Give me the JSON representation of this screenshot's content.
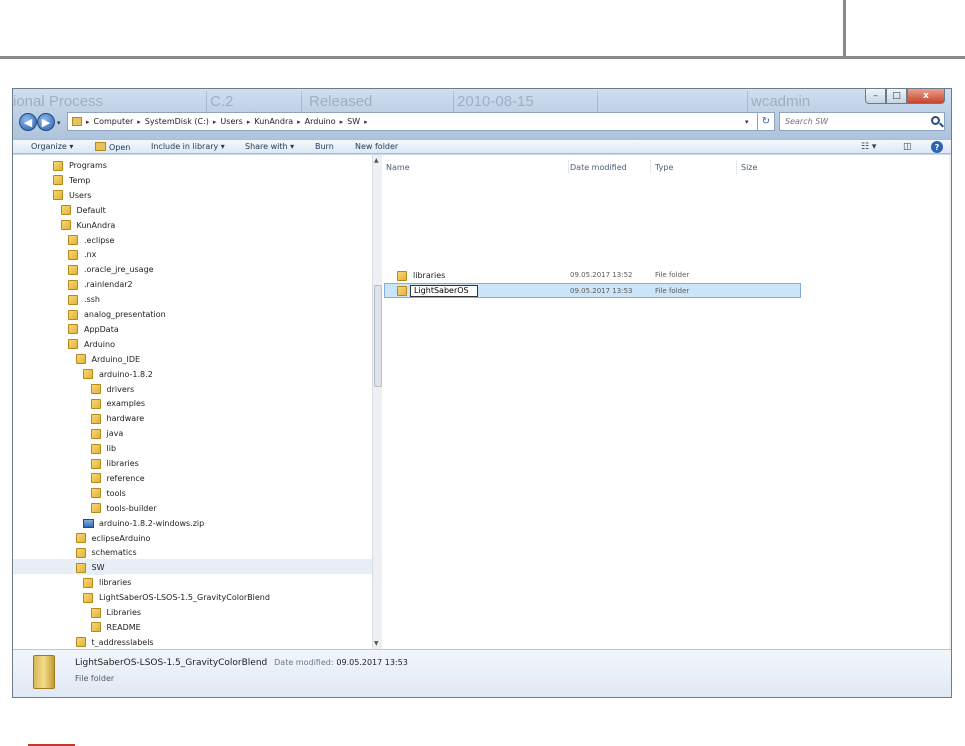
{
  "ghost_text": [
    "ional Process",
    "C.2",
    "Released",
    "2010-08-15",
    "wcadmin"
  ],
  "window_buttons": {
    "minimize": "–",
    "maximize": "□",
    "close": "x"
  },
  "nav": {
    "back_glyph": "◀",
    "forward_glyph": "▶",
    "breadcrumb": [
      "Computer",
      "SystemDisk (C:)",
      "Users",
      "KunAndra",
      "Arduino",
      "SW"
    ],
    "search_placeholder": "Search SW"
  },
  "toolbar": {
    "organize": "Organize ▾",
    "open": "Open",
    "include": "Include in library ▾",
    "share": "Share with ▾",
    "burn": "Burn",
    "new_folder": "New folder"
  },
  "tree": [
    {
      "label": "Programs",
      "indent": 0,
      "icon": "folder"
    },
    {
      "label": "Temp",
      "indent": 0,
      "icon": "folder"
    },
    {
      "label": "Users",
      "indent": 0,
      "icon": "folder"
    },
    {
      "label": "Default",
      "indent": 1,
      "icon": "folder"
    },
    {
      "label": "KunAndra",
      "indent": 1,
      "icon": "folder"
    },
    {
      "label": ".eclipse",
      "indent": 2,
      "icon": "folder"
    },
    {
      "label": ".nx",
      "indent": 2,
      "icon": "folder"
    },
    {
      "label": ".oracle_jre_usage",
      "indent": 2,
      "icon": "folder"
    },
    {
      "label": ".rainlendar2",
      "indent": 2,
      "icon": "folder"
    },
    {
      "label": ".ssh",
      "indent": 2,
      "icon": "folder"
    },
    {
      "label": "analog_presentation",
      "indent": 2,
      "icon": "folder"
    },
    {
      "label": "AppData",
      "indent": 2,
      "icon": "folder"
    },
    {
      "label": "Arduino",
      "indent": 2,
      "icon": "folder"
    },
    {
      "label": "Arduino_IDE",
      "indent": 3,
      "icon": "folder"
    },
    {
      "label": "arduino-1.8.2",
      "indent": 4,
      "icon": "folder"
    },
    {
      "label": "drivers",
      "indent": 5,
      "icon": "folder"
    },
    {
      "label": "examples",
      "indent": 5,
      "icon": "folder"
    },
    {
      "label": "hardware",
      "indent": 5,
      "icon": "folder"
    },
    {
      "label": "java",
      "indent": 5,
      "icon": "folder"
    },
    {
      "label": "lib",
      "indent": 5,
      "icon": "folder"
    },
    {
      "label": "libraries",
      "indent": 5,
      "icon": "folder"
    },
    {
      "label": "reference",
      "indent": 5,
      "icon": "folder"
    },
    {
      "label": "tools",
      "indent": 5,
      "icon": "folder"
    },
    {
      "label": "tools-builder",
      "indent": 5,
      "icon": "folder"
    },
    {
      "label": "arduino-1.8.2-windows.zip",
      "indent": 4,
      "icon": "zip"
    },
    {
      "label": "eclipseArduino",
      "indent": 3,
      "icon": "folder"
    },
    {
      "label": "schematics",
      "indent": 3,
      "icon": "folder"
    },
    {
      "label": "SW",
      "indent": 3,
      "icon": "folder",
      "selected": true
    },
    {
      "label": "libraries",
      "indent": 4,
      "icon": "folder"
    },
    {
      "label": "LightSaberOS-LSOS-1.5_GravityColorBlend",
      "indent": 4,
      "icon": "folder"
    },
    {
      "label": "Libraries",
      "indent": 5,
      "icon": "folder"
    },
    {
      "label": "README",
      "indent": 5,
      "icon": "folder"
    },
    {
      "label": "t_addresslabels",
      "indent": 3,
      "icon": "folder"
    }
  ],
  "columns": {
    "name": "Name",
    "date": "Date modified",
    "type": "Type",
    "size": "Size"
  },
  "files": [
    {
      "name": "libraries",
      "date": "09.05.2017 13:52",
      "type": "File folder",
      "selected": false
    },
    {
      "name": "LightSaberOS",
      "date": "09.05.2017 13:53",
      "type": "File folder",
      "selected": true
    }
  ],
  "details": {
    "name": "LightSaberOS-LSOS-1.5_GravityColorBlend",
    "date_label": "Date modified:",
    "date": "09.05.2017 13:53",
    "type": "File folder"
  }
}
